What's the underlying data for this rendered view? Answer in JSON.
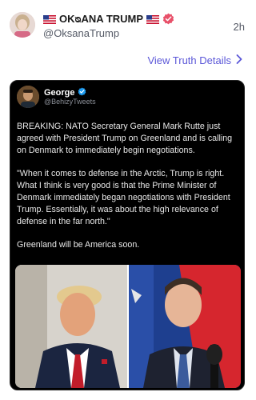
{
  "post": {
    "display_name": "OKᴓANA TRUMP",
    "handle": "@OksanaTrump",
    "timestamp": "2h",
    "view_details_label": "View Truth Details"
  },
  "quoted": {
    "name": "George",
    "handle": "@BehizyTweets",
    "paragraphs": [
      "BREAKING: NATO Secretary General Mark Rutte just agreed with President Trump on Greenland and is calling on Denmark to immediately begin negotiations.",
      "\"When it comes to defense in the Arctic, Trump is right. What I think is very good is that the Prime Minister of Denmark immediately began negotiations with President Trump. Essentially, it was about the high relevance of defense in the far north.\"",
      "Greenland will be America soon."
    ]
  },
  "colors": {
    "link": "#5b57d8",
    "verified_badge_pink": "#e8516a",
    "verified_badge_blue": "#1d9bf0",
    "card_bg": "#000000"
  },
  "icons": {
    "flag_left": "us-flag-icon",
    "flag_right": "us-flag-icon",
    "badge": "verified-badge-icon",
    "chevron": "chevron-right-icon"
  }
}
